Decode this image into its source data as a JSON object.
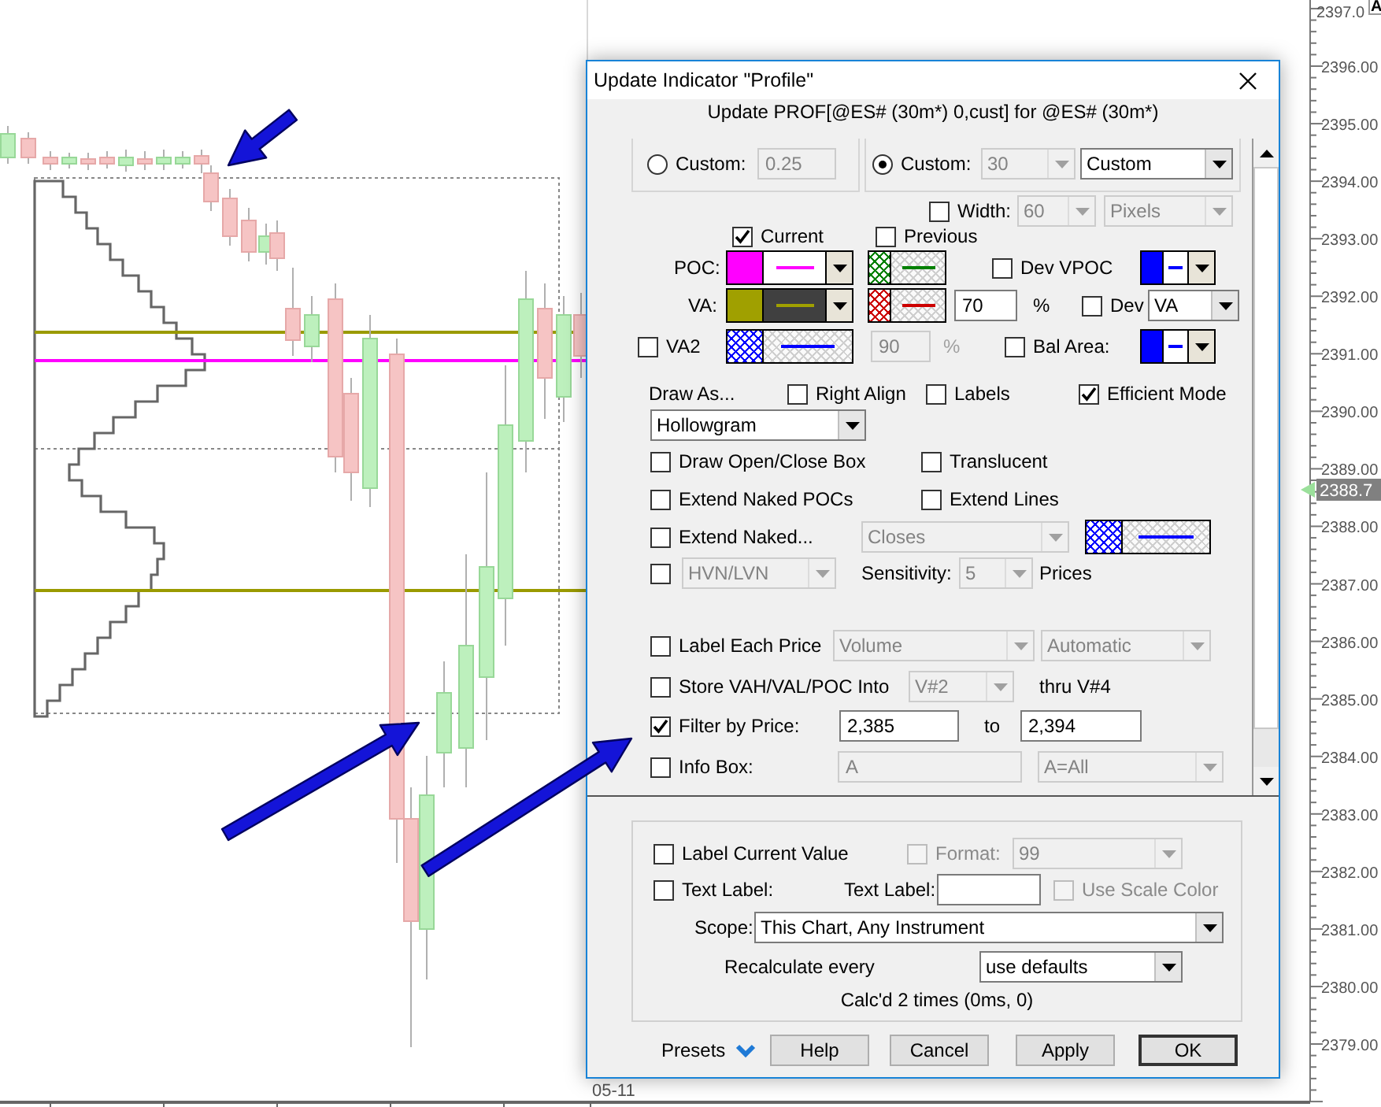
{
  "chart": {
    "price_labels": [
      "2397.0",
      "2396.00",
      "2395.00",
      "2394.00",
      "2393.00",
      "2392.00",
      "2391.00",
      "2390.00",
      "2389.00",
      "2388.00",
      "2387.00",
      "2386.00",
      "2385.00",
      "2384.00",
      "2383.00",
      "2382.00",
      "2381.00",
      "2380.00",
      "2379.00"
    ],
    "current_price": "2388.7",
    "corner_badge": "A",
    "date_label": "05-11"
  },
  "dialog": {
    "title": "Update Indicator \"Profile\"",
    "subtitle": "Update PROF[@ES# (30m*) 0,cust] for @ES# (30m*)",
    "groups": [
      {
        "items": [
          {
            "kind": "radio",
            "label": "Custom:",
            "selected": false
          },
          {
            "kind": "field",
            "value": "0.25",
            "disabled": true
          }
        ]
      },
      {
        "items": [
          {
            "kind": "radio",
            "label": "Custom:",
            "selected": true
          },
          {
            "kind": "dropdown",
            "value": "30",
            "disabled": true
          },
          {
            "kind": "dropdown",
            "value": "Custom",
            "disabled": false
          }
        ]
      }
    ],
    "rows": [
      {
        "items": [
          {
            "kind": "checkbox",
            "label": "Width:",
            "checked": false,
            "disabled": false
          },
          {
            "kind": "dropdown",
            "value": "60",
            "disabled": true
          },
          {
            "kind": "dropdown",
            "value": "Pixels",
            "disabled": true
          }
        ]
      },
      {
        "items": [
          {
            "kind": "checkbox",
            "label": "Current",
            "checked": true,
            "disabled": false
          },
          {
            "kind": "checkbox",
            "label": "Previous",
            "checked": false,
            "disabled": false
          }
        ]
      },
      {
        "items": [
          {
            "kind": "label",
            "text": "POC:",
            "disabled": false
          },
          {
            "kind": "style_combo",
            "color": "#ff00ff",
            "dark": false
          },
          {
            "kind": "hatch",
            "color": "#008000"
          },
          {
            "kind": "checkbox",
            "label": "Dev VPOC",
            "checked": false,
            "disabled": false
          },
          {
            "kind": "style_combo",
            "color": "#0000ff",
            "dark": false
          }
        ]
      },
      {
        "items": [
          {
            "kind": "label",
            "text": "VA:",
            "disabled": false
          },
          {
            "kind": "style_combo",
            "color": "#a0a000",
            "dark": true
          },
          {
            "kind": "hatch",
            "color": "#cc0000"
          },
          {
            "kind": "field",
            "value": "70",
            "disabled": false
          },
          {
            "kind": "label",
            "text": "%",
            "disabled": false
          },
          {
            "kind": "checkbox",
            "label": "Dev",
            "checked": false,
            "disabled": false
          },
          {
            "kind": "dropdown",
            "value": "VA",
            "disabled": false
          }
        ]
      },
      {
        "items": [
          {
            "kind": "checkbox",
            "label": "VA2",
            "checked": false,
            "disabled": false
          },
          {
            "kind": "hatch",
            "color": "#0000ff"
          },
          {
            "kind": "field",
            "value": "90",
            "disabled": true
          },
          {
            "kind": "label",
            "text": "%",
            "disabled": true
          },
          {
            "kind": "checkbox",
            "label": "Bal Area:",
            "checked": false,
            "disabled": false
          },
          {
            "kind": "style_combo",
            "color": "#0000ff",
            "dark": false
          }
        ]
      },
      {
        "items": [
          {
            "kind": "label",
            "text": "Draw As...",
            "disabled": false
          },
          {
            "kind": "checkbox",
            "label": "Right Align",
            "checked": false,
            "disabled": false
          },
          {
            "kind": "checkbox",
            "label": "Labels",
            "checked": false,
            "disabled": false
          },
          {
            "kind": "checkbox",
            "label": "Efficient Mode",
            "checked": true,
            "disabled": false
          }
        ]
      },
      {
        "items": [
          {
            "kind": "dropdown",
            "value": "Hollowgram",
            "disabled": false
          }
        ]
      },
      {
        "items": [
          {
            "kind": "checkbox",
            "label": "Draw Open/Close Box",
            "checked": false,
            "disabled": false
          },
          {
            "kind": "checkbox",
            "label": "Translucent",
            "checked": false,
            "disabled": false
          }
        ]
      },
      {
        "items": [
          {
            "kind": "checkbox",
            "label": "Extend Naked POCs",
            "checked": false,
            "disabled": false
          },
          {
            "kind": "checkbox",
            "label": "Extend Lines",
            "checked": false,
            "disabled": false
          }
        ]
      },
      {
        "items": [
          {
            "kind": "checkbox",
            "label": "Extend Naked...",
            "checked": false,
            "disabled": false
          },
          {
            "kind": "dropdown",
            "value": "Closes",
            "disabled": true
          },
          {
            "kind": "hatch",
            "color": "#0000ff"
          }
        ]
      },
      {
        "items": [
          {
            "kind": "checkbox",
            "checked": false,
            "disabled": false
          },
          {
            "kind": "dropdown",
            "value": "HVN/LVN",
            "disabled": true
          },
          {
            "kind": "label",
            "text": "Sensitivity:",
            "disabled": false
          },
          {
            "kind": "dropdown",
            "value": "5",
            "disabled": true
          },
          {
            "kind": "label",
            "text": "Prices",
            "disabled": false
          }
        ]
      },
      {
        "items": [
          {
            "kind": "checkbox",
            "label": "Label Each Price",
            "checked": false,
            "disabled": false
          },
          {
            "kind": "dropdown",
            "value": "Volume",
            "disabled": true
          },
          {
            "kind": "dropdown",
            "value": "Automatic",
            "disabled": true
          }
        ]
      },
      {
        "items": [
          {
            "kind": "checkbox",
            "label": "Store VAH/VAL/POC Into",
            "checked": false,
            "disabled": false
          },
          {
            "kind": "dropdown",
            "value": "V#2",
            "disabled": true
          },
          {
            "kind": "label",
            "text": "thru V#4",
            "disabled": false
          }
        ]
      },
      {
        "items": [
          {
            "kind": "checkbox",
            "label": "Filter by Price:",
            "checked": true,
            "disabled": false
          },
          {
            "kind": "field",
            "value": "2,385",
            "disabled": false
          },
          {
            "kind": "label",
            "text": "to",
            "disabled": false
          },
          {
            "kind": "field",
            "value": "2,394",
            "disabled": false
          }
        ]
      },
      {
        "items": [
          {
            "kind": "checkbox",
            "label": "Info Box:",
            "checked": false,
            "disabled": false
          },
          {
            "kind": "field",
            "value": "A",
            "disabled": true
          },
          {
            "kind": "dropdown",
            "value": "A=All",
            "disabled": true
          }
        ]
      }
    ],
    "options": {
      "rows": [
        {
          "items": [
            {
              "kind": "checkbox",
              "label": "Label Current Value",
              "checked": false,
              "disabled": false
            },
            {
              "kind": "checkbox",
              "label": "Format:",
              "checked": false,
              "disabled": true
            },
            {
              "kind": "dropdown",
              "value": "99",
              "disabled": true
            }
          ]
        },
        {
          "items": [
            {
              "kind": "checkbox",
              "label": "Text Label:",
              "checked": false,
              "disabled": false
            },
            {
              "kind": "label",
              "text": "Text Label:",
              "disabled": false
            },
            {
              "kind": "field",
              "disabled": false
            },
            {
              "kind": "checkbox",
              "label": "Use Scale Color",
              "checked": false,
              "disabled": true
            }
          ]
        },
        {
          "items": [
            {
              "kind": "label",
              "text": "Scope:",
              "disabled": false
            },
            {
              "kind": "dropdown",
              "value": "This Chart, Any Instrument",
              "disabled": false
            }
          ]
        },
        {
          "items": [
            {
              "kind": "label",
              "text": "Recalculate every",
              "disabled": false
            },
            {
              "kind": "dropdown",
              "value": "use defaults",
              "disabled": false
            }
          ]
        }
      ],
      "status": "Calc'd 2 times (0ms, 0)"
    },
    "presets": "Presets",
    "buttons": [
      {
        "label": "Help",
        "default": false
      },
      {
        "label": "Cancel",
        "default": false
      },
      {
        "label": "Apply",
        "default": false
      },
      {
        "label": "OK",
        "default": true
      }
    ]
  }
}
